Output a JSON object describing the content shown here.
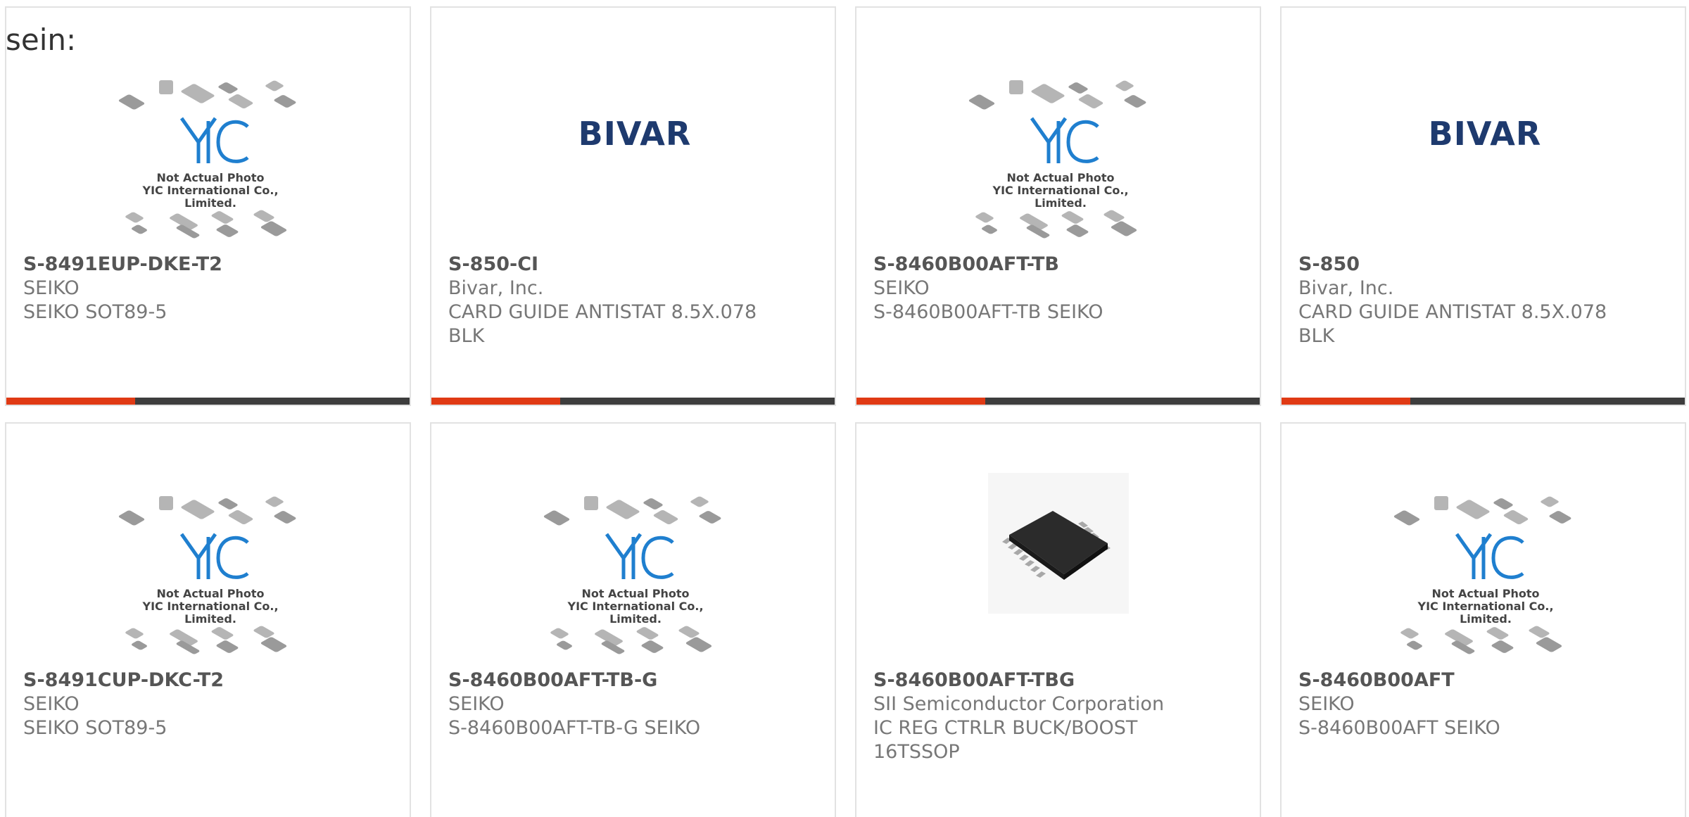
{
  "leading_text": "sein:",
  "placeholder_image": {
    "line1": "Not Actual Photo",
    "line2": "YIC International Co., Limited."
  },
  "bivar_logo_text": "BIVAR",
  "colors": {
    "accent": "#e03a14",
    "bar": "#3d3d3d",
    "card_border": "#e2e2e2",
    "logo_blue": "#1e3a6e",
    "yic_blue": "#1f7fcf"
  },
  "products": [
    {
      "part": "S-8491EUP-DKE-T2",
      "maker": "SEIKO",
      "desc": "SEIKO SOT89-5",
      "image": "placeholder"
    },
    {
      "part": "S-850-CI",
      "maker": "Bivar, Inc.",
      "desc": "CARD GUIDE ANTISTAT 8.5X.078 BLK",
      "image": "bivar-logo"
    },
    {
      "part": "S-8460B00AFT-TB",
      "maker": "SEIKO",
      "desc": "S-8460B00AFT-TB SEIKO",
      "image": "placeholder"
    },
    {
      "part": "S-850",
      "maker": "Bivar, Inc.",
      "desc": "CARD GUIDE ANTISTAT 8.5X.078 BLK",
      "image": "bivar-logo"
    },
    {
      "part": "S-8491CUP-DKC-T2",
      "maker": "SEIKO",
      "desc": "SEIKO SOT89-5",
      "image": "placeholder"
    },
    {
      "part": "S-8460B00AFT-TB-G",
      "maker": "SEIKO",
      "desc": "S-8460B00AFT-TB-G SEIKO",
      "image": "placeholder"
    },
    {
      "part": "S-8460B00AFT-TBG",
      "maker": "SII Semiconductor Corporation",
      "desc": "IC REG CTRLR BUCK/BOOST 16TSSOP",
      "image": "tssop-photo"
    },
    {
      "part": "S-8460B00AFT",
      "maker": "SEIKO",
      "desc": "S-8460B00AFT SEIKO",
      "image": "placeholder"
    }
  ]
}
